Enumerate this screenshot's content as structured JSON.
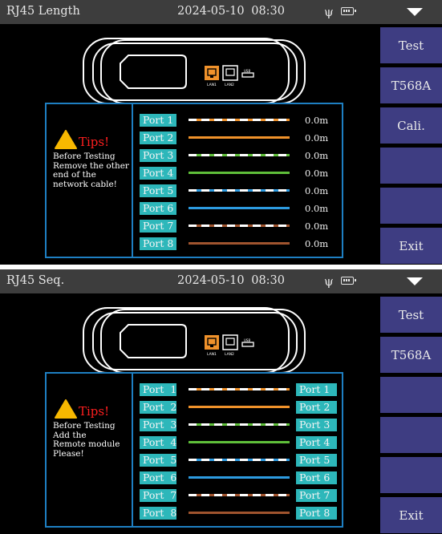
{
  "colors": {
    "accent_blue": "#1e7fc2",
    "port_label_bg": "#2db7ba",
    "sidebar_button": "#3e3d82",
    "status_bar": "#3d3d3d",
    "tips_red": "#ff1f1f",
    "warning_yellow": "#f7b800"
  },
  "screens": [
    {
      "status": {
        "title": "RJ45 Length",
        "date": "2024-05-10",
        "time": "08:30",
        "icons": [
          "usb-icon",
          "battery-icon",
          "dropdown-menu-icon"
        ]
      },
      "sidebar": [
        "Test",
        "T568A",
        "Cali.",
        "",
        "",
        "Exit"
      ],
      "device": {
        "port_labels": [
          "LAN1",
          "LAN2",
          "USB"
        ]
      },
      "tips": {
        "title": "Tips!",
        "lines": [
          "Before Testing",
          "Remove the other",
          "end of the",
          "network cable!"
        ]
      },
      "ports": [
        {
          "label": "Port 1",
          "value": "0.0m",
          "wire": "white-orange"
        },
        {
          "label": "Port 2",
          "value": "0.0m",
          "wire": "orange"
        },
        {
          "label": "Port 3",
          "value": "0.0m",
          "wire": "white-green"
        },
        {
          "label": "Port 4",
          "value": "0.0m",
          "wire": "green"
        },
        {
          "label": "Port 5",
          "value": "0.0m",
          "wire": "white-blue"
        },
        {
          "label": "Port 6",
          "value": "0.0m",
          "wire": "blue"
        },
        {
          "label": "Port 7",
          "value": "0.0m",
          "wire": "white-brown"
        },
        {
          "label": "Port 8",
          "value": "0.0m",
          "wire": "brown"
        }
      ]
    },
    {
      "status": {
        "title": "RJ45 Seq.",
        "date": "2024-05-10",
        "time": "08:30",
        "icons": [
          "usb-icon",
          "battery-icon",
          "dropdown-menu-icon"
        ]
      },
      "sidebar": [
        "Test",
        "T568A",
        "",
        "",
        "",
        "Exit"
      ],
      "device": {
        "port_labels": [
          "LAN1",
          "LAN2",
          "USB"
        ]
      },
      "tips": {
        "title": "Tips!",
        "lines": [
          "Before Testing",
          "Add the",
          "Remote module",
          "Please!"
        ]
      },
      "ports": [
        {
          "label": "Port  1",
          "right": "Port 1",
          "wire": "white-orange"
        },
        {
          "label": "Port  2",
          "right": "Port 2",
          "wire": "orange"
        },
        {
          "label": "Port  3",
          "right": "Port 3",
          "wire": "white-green"
        },
        {
          "label": "Port  4",
          "right": "Port 4",
          "wire": "green"
        },
        {
          "label": "Port  5",
          "right": "Port 5",
          "wire": "white-blue"
        },
        {
          "label": "Port  6",
          "right": "Port 6",
          "wire": "blue"
        },
        {
          "label": "Port  7",
          "right": "Port 7",
          "wire": "white-brown"
        },
        {
          "label": "Port  8",
          "right": "Port 8",
          "wire": "brown"
        }
      ]
    }
  ],
  "wire_colors": {
    "orange": "#f0922b",
    "green": "#5fbf3a",
    "blue": "#2d9be0",
    "brown": "#a0542e"
  }
}
